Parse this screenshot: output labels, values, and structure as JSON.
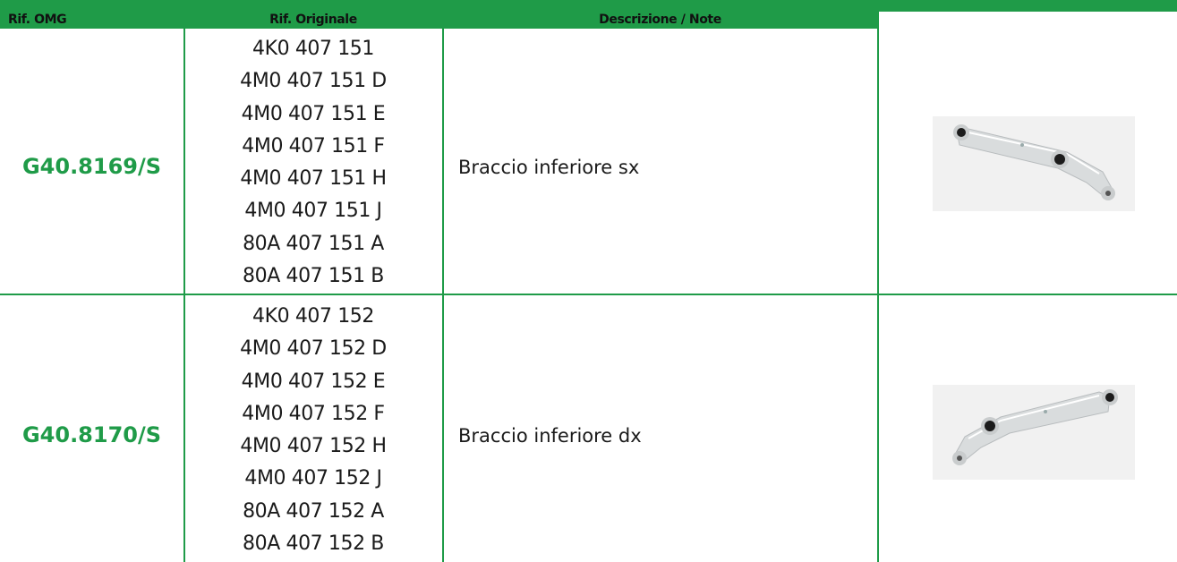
{
  "header": {
    "col_omg": "Rif. OMG",
    "col_original": "Rif. Originale",
    "col_description": "Descrizione / Note"
  },
  "rows": [
    {
      "code": "G40.8169/S",
      "refs": [
        "4K0 407 151",
        "4M0 407 151 D",
        "4M0 407 151 E",
        "4M0 407 151 F",
        "4M0 407 151 H",
        "4M0 407 151 J",
        "80A 407 151 A",
        "80A 407 151 B"
      ],
      "description": "Braccio inferiore sx",
      "image": "lower-control-arm-left-photo"
    },
    {
      "code": "G40.8170/S",
      "refs": [
        "4K0 407 152",
        "4M0 407 152 D",
        "4M0 407 152 E",
        "4M0 407 152 F",
        "4M0 407 152 H",
        "4M0 407 152 J",
        "80A 407 152 A",
        "80A 407 152 B"
      ],
      "description": "Braccio inferiore dx",
      "image": "lower-control-arm-right-photo"
    }
  ],
  "colors": {
    "brand_green": "#1f9b48",
    "text": "#1a1a1a"
  }
}
